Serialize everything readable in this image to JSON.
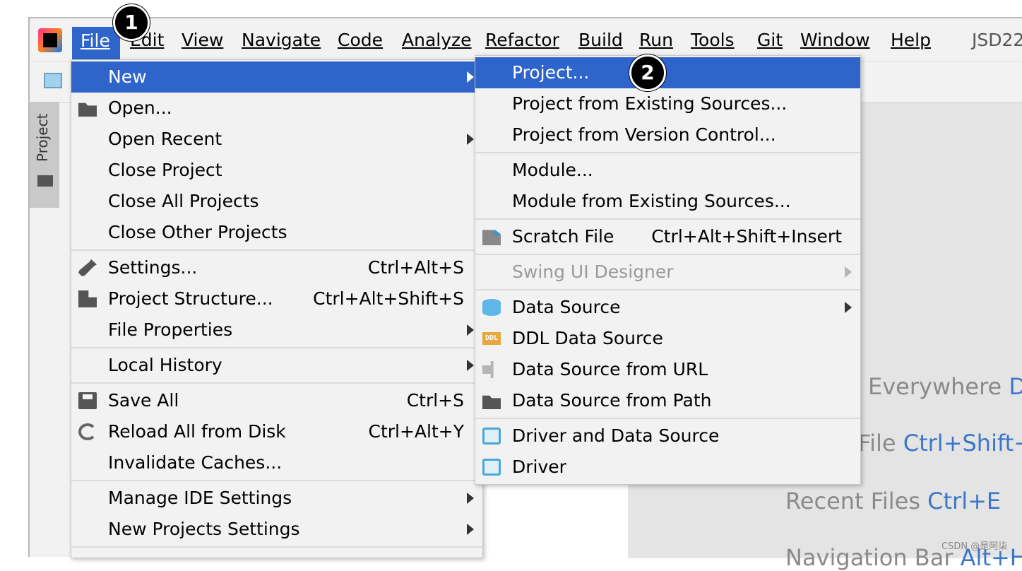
{
  "menubar": {
    "items": [
      "File",
      "Edit",
      "View",
      "Navigate",
      "Code",
      "Analyze",
      "Refactor",
      "Build",
      "Run",
      "Tools",
      "Git",
      "Window",
      "Help"
    ],
    "project_title": "JSD22"
  },
  "sidebar": {
    "label": "Project"
  },
  "file_menu": {
    "items": [
      {
        "label": "New",
        "shortcut": ""
      },
      {
        "label": "Open...",
        "shortcut": ""
      },
      {
        "label": "Open Recent",
        "shortcut": ""
      },
      {
        "label": "Close Project",
        "shortcut": ""
      },
      {
        "label": "Close All Projects",
        "shortcut": ""
      },
      {
        "label": "Close Other Projects",
        "shortcut": ""
      },
      {
        "label": "Settings...",
        "shortcut": "Ctrl+Alt+S"
      },
      {
        "label": "Project Structure...",
        "shortcut": "Ctrl+Alt+Shift+S"
      },
      {
        "label": "File Properties",
        "shortcut": ""
      },
      {
        "label": "Local History",
        "shortcut": ""
      },
      {
        "label": "Save All",
        "shortcut": "Ctrl+S"
      },
      {
        "label": "Reload All from Disk",
        "shortcut": "Ctrl+Alt+Y"
      },
      {
        "label": "Invalidate Caches...",
        "shortcut": ""
      },
      {
        "label": "Manage IDE Settings",
        "shortcut": ""
      },
      {
        "label": "New Projects Settings",
        "shortcut": ""
      }
    ]
  },
  "new_menu": {
    "items": [
      {
        "label": "Project...",
        "shortcut": ""
      },
      {
        "label": "Project from Existing Sources...",
        "shortcut": ""
      },
      {
        "label": "Project from Version Control...",
        "shortcut": ""
      },
      {
        "label": "Module...",
        "shortcut": ""
      },
      {
        "label": "Module from Existing Sources...",
        "shortcut": ""
      },
      {
        "label": "Scratch File",
        "shortcut": "Ctrl+Alt+Shift+Insert"
      },
      {
        "label": "Swing UI Designer",
        "shortcut": ""
      },
      {
        "label": "Data Source",
        "shortcut": ""
      },
      {
        "label": "DDL Data Source",
        "shortcut": ""
      },
      {
        "label": "Data Source from URL",
        "shortcut": ""
      },
      {
        "label": "Data Source from Path",
        "shortcut": ""
      },
      {
        "label": "Driver and Data Source",
        "shortcut": ""
      },
      {
        "label": "Driver",
        "shortcut": ""
      }
    ]
  },
  "welcome": {
    "lines": [
      {
        "text": "Everywhere",
        "shortcut": "D"
      },
      {
        "text": "File",
        "shortcut": "Ctrl+Shift+"
      },
      {
        "text": "Recent Files",
        "shortcut": "Ctrl+E"
      },
      {
        "text": "Navigation Bar",
        "shortcut": "Alt+H"
      }
    ]
  },
  "badges": [
    "1",
    "2"
  ],
  "watermark": "CSDN @是阿柒",
  "colors": {
    "selection": "#2f65ca",
    "menu_bg": "#f2f2f2",
    "shortcut_link": "#3b77c9"
  }
}
